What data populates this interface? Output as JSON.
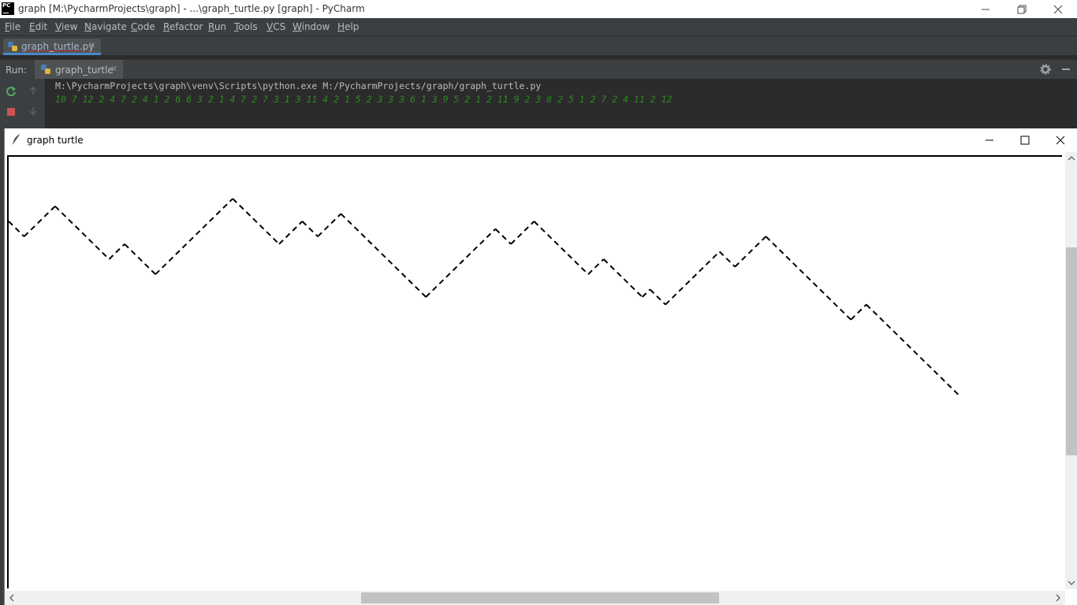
{
  "ide": {
    "title": "graph [M:\\PycharmProjects\\graph] - ...\\graph_turtle.py [graph] - PyCharm",
    "menu": [
      {
        "label": "File",
        "mnemonic": "F",
        "rest": "ile"
      },
      {
        "label": "Edit",
        "mnemonic": "E",
        "rest": "dit"
      },
      {
        "label": "View",
        "mnemonic": "V",
        "rest": "iew"
      },
      {
        "label": "Navigate",
        "mnemonic": "N",
        "rest": "avigate"
      },
      {
        "label": "Code",
        "mnemonic": "C",
        "rest": "ode"
      },
      {
        "label": "Refactor",
        "mnemonic": "R",
        "rest": "efactor"
      },
      {
        "label": "Run",
        "mnemonic": "R",
        "rest": "un"
      },
      {
        "label": "Tools",
        "mnemonic": "T",
        "rest": "ools"
      },
      {
        "label": "VCS",
        "mnemonic": "V",
        "rest": "CS"
      },
      {
        "label": "Window",
        "mnemonic": "W",
        "rest": "indow"
      },
      {
        "label": "Help",
        "mnemonic": "H",
        "rest": "elp"
      }
    ],
    "editor_tab": "graph_turtle.py",
    "run_label": "Run:",
    "run_tab": "graph_turtle",
    "console_lines": [
      "M:\\PycharmProjects\\graph\\venv\\Scripts\\python.exe M:/PycharmProjects/graph/graph_turtle.py",
      "10 7 12 2 4 7 2 4 1 2 6 6 3 2 1 4 7 2 7 3 1 3 11 4 2 1 5 2 3 3 3 6 1 3 9 5 2 1 2 11 9 2 3 8 2 5 1 2 7 2 4 11 2 12"
    ]
  },
  "turtle_window": {
    "title": "graph turtle",
    "line_color": "#000000",
    "path": [
      {
        "angle": -45,
        "count": 2
      },
      {
        "angle": 45,
        "count": 4
      },
      {
        "angle": -45,
        "count": 7
      },
      {
        "angle": 45,
        "count": 2
      },
      {
        "angle": -45,
        "count": 4
      },
      {
        "angle": 45,
        "count": 10
      },
      {
        "angle": -45,
        "count": 6
      },
      {
        "angle": 45,
        "count": 3
      },
      {
        "angle": -45,
        "count": 2
      },
      {
        "angle": 45,
        "count": 3
      },
      {
        "angle": -45,
        "count": 11
      },
      {
        "angle": 45,
        "count": 9
      },
      {
        "angle": -45,
        "count": 2
      },
      {
        "angle": 45,
        "count": 3
      },
      {
        "angle": -45,
        "count": 7
      },
      {
        "angle": 45,
        "count": 2
      },
      {
        "angle": -45,
        "count": 5
      },
      {
        "angle": 45,
        "count": 1
      },
      {
        "angle": -45,
        "count": 2
      },
      {
        "angle": 45,
        "count": 7
      },
      {
        "angle": -45,
        "count": 2
      },
      {
        "angle": 45,
        "count": 4
      },
      {
        "angle": -45,
        "count": 11
      },
      {
        "angle": 45,
        "count": 2
      },
      {
        "angle": -45,
        "count": 12
      }
    ]
  }
}
